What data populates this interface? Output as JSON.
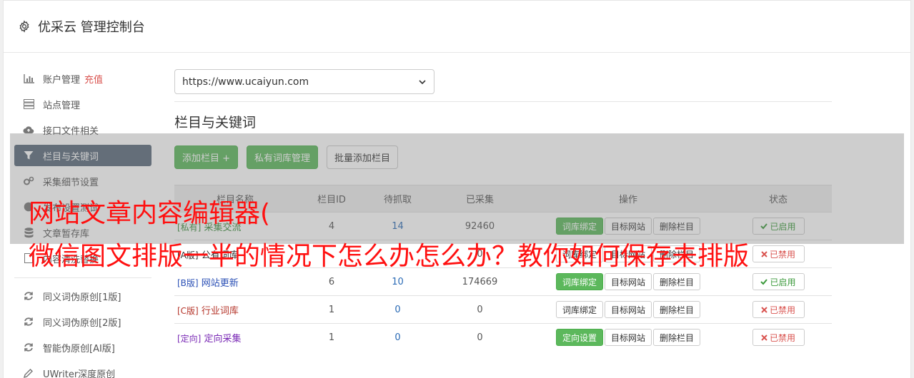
{
  "header": {
    "title": "优采云 管理控制台",
    "icon": "gear-icon"
  },
  "sidebar": {
    "group1": [
      {
        "label": "账户管理",
        "extra": "充值",
        "icon": "bar-chart-icon"
      },
      {
        "label": "站点管理",
        "icon": "server-icon"
      },
      {
        "label": "接口文件相关",
        "icon": "cloud-upload-icon"
      },
      {
        "label": "栏目与关键词",
        "icon": "filter-icon",
        "active": true
      },
      {
        "label": "采集细节设置",
        "icon": "cogs-icon"
      },
      {
        "label": "发布设置测试",
        "icon": "globe-icon"
      },
      {
        "label": "文章暂存库",
        "icon": "database-icon"
      },
      {
        "label": "内容清洗替换",
        "icon": "file-icon"
      }
    ],
    "group2": [
      {
        "label": "同义词伪原创[1版]",
        "icon": "refresh-icon"
      },
      {
        "label": "同义词伪原创[2版]",
        "icon": "refresh-icon"
      },
      {
        "label": "智能伪原创[AI版]",
        "icon": "refresh-icon"
      },
      {
        "label": "UWriter深度原创",
        "icon": "edit-icon"
      }
    ]
  },
  "main": {
    "site_select": "https://www.ucaiyun.com",
    "section_title": "栏目与关键词",
    "toolbar": {
      "add_column": "添加栏目 +",
      "private_lib": "私有词库管理",
      "batch_add": "批量添加栏目"
    },
    "table": {
      "headers": [
        "栏目名称",
        "栏目ID",
        "待抓取",
        "已采集",
        "操作",
        "状态"
      ],
      "rows": [
        {
          "tag": "[私有]",
          "name": "采集交流",
          "id": "4",
          "pending": "14",
          "collected": "92460",
          "action1": "词库绑定",
          "action2": "目标网站",
          "action3": "删除栏目",
          "status": "已启用",
          "color": "#3a8a3a",
          "a1green": true,
          "on": true
        },
        {
          "tag": "[A版]",
          "name": "公有词库",
          "id": "",
          "pending": "",
          "collected": "0",
          "action1": "词库绑定",
          "action2": "目标网站",
          "action3": "删除栏目",
          "status": "已禁用",
          "color": "#333333",
          "a1green": false,
          "on": false
        },
        {
          "tag": "[B版]",
          "name": "网站更新",
          "id": "6",
          "pending": "10",
          "collected": "174669",
          "action1": "词库绑定",
          "action2": "目标网站",
          "action3": "删除栏目",
          "status": "已启用",
          "color": "#2a4fb5",
          "a1green": true,
          "on": true
        },
        {
          "tag": "[C版]",
          "name": "行业词库",
          "id": "1",
          "pending": "0",
          "collected": "0",
          "action1": "词库绑定",
          "action2": "目标网站",
          "action3": "删除栏目",
          "status": "已禁用",
          "color": "#b5352a",
          "a1green": false,
          "on": false
        },
        {
          "tag": "[定向]",
          "name": "定向采集",
          "id": "1",
          "pending": "0",
          "collected": "0",
          "action1": "定向设置",
          "action2": "目标网站",
          "action3": "删除栏目",
          "status": "已禁用",
          "color": "#7a2ab5",
          "a1green": true,
          "on": false
        }
      ]
    }
  },
  "overlay": {
    "line1": "网站文章内容编辑器(",
    "line2": "微信图文排版一半的情况下怎么办怎么办？教你如何保存未排版"
  }
}
